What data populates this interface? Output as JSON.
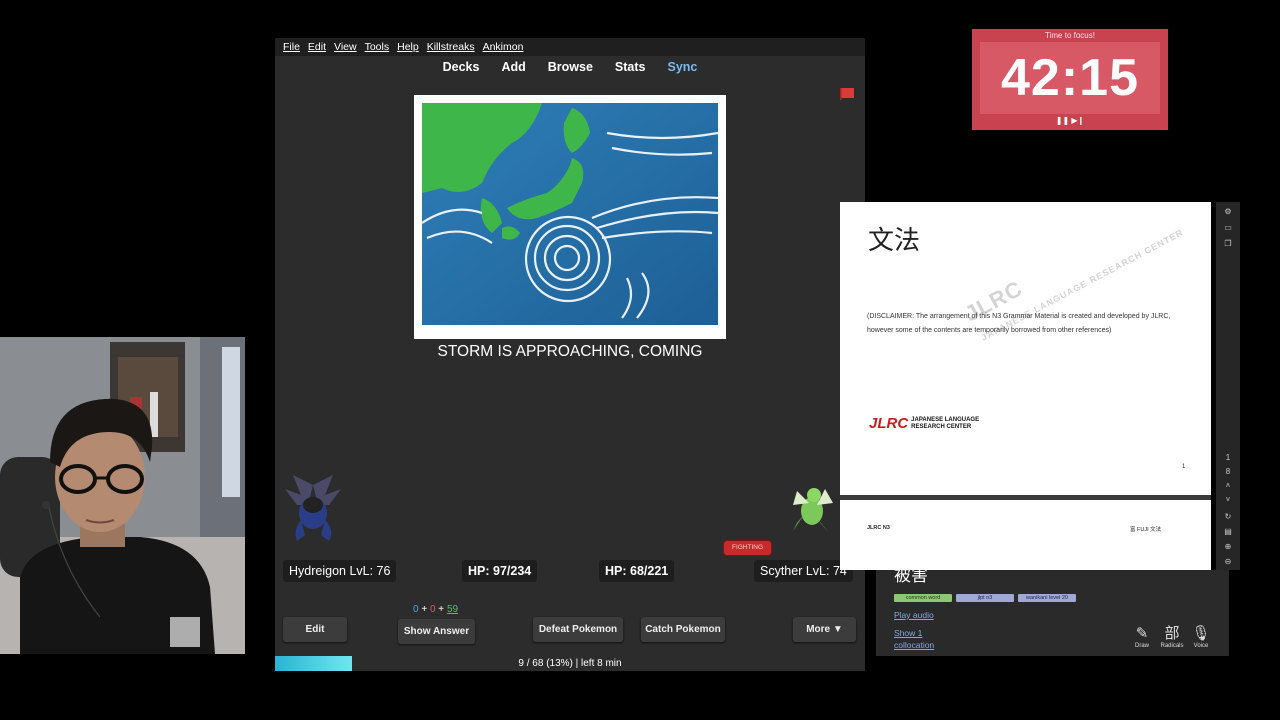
{
  "anki": {
    "menu": [
      "File",
      "Edit",
      "View",
      "Tools",
      "Help",
      "Killstreaks",
      "Ankimon"
    ],
    "toolbar": {
      "decks": "Decks",
      "add": "Add",
      "browse": "Browse",
      "stats": "Stats",
      "sync": "Sync"
    },
    "card_text": "STORM IS APPROACHING, COMING",
    "battle": {
      "player_name": "Hydreigon LvL: 76",
      "player_hp": "HP: 97/234",
      "enemy_hp": "HP: 68/221",
      "enemy_name": "Scyther LvL: 74",
      "enemy_type": "FIGHTING"
    },
    "counts": {
      "new": "0",
      "sep1": " + ",
      "learn": "0",
      "sep2": " + ",
      "review": "59"
    },
    "buttons": {
      "edit": "Edit",
      "show_answer": "Show Answer",
      "defeat": "Defeat Pokemon",
      "catch": "Catch Pokemon",
      "more": "More ▼"
    },
    "progress": {
      "fraction": 0.13,
      "text": "9 / 68 (13%) | left 8 min"
    }
  },
  "timer": {
    "label": "Time to focus!",
    "value": "42:15",
    "controls": "❚❚ ▶❙"
  },
  "pdf": {
    "title": "文法",
    "watermark_big": "JLRC",
    "watermark_small": "JAPANESE LANGUAGE RESEARCH CENTER",
    "disclaimer": "(DISCLAIMER: The arrangement of this N3 Grammar Material is created and developed by JLRC, however some of the contents are temporarily borrowed from other references)",
    "logo_big": "JLRC",
    "logo_small_1": "JAPANESE LANGUAGE",
    "logo_small_2": "RESEARCH CENTER",
    "page_number": "1",
    "page2_left": "JLRC N3",
    "page2_right": "富 FUJI 文法",
    "side_icons": [
      "settings-icon",
      "bookmark-icon",
      "copy-icon",
      "page-icon",
      "chevron-down-icon",
      "refresh-icon",
      "document-icon",
      "zoom-in-icon",
      "zoom-out-icon"
    ],
    "side_page": "1",
    "side_page_total": "8"
  },
  "dictionary": {
    "word": "被害",
    "tags": [
      "common word",
      "jlpt n3",
      "wanikani level 20"
    ],
    "play_audio": "Play audio",
    "show": "Show 1",
    "collocation": "collocation",
    "tools": {
      "draw": "Draw",
      "radicals": "Radicals",
      "voice": "Voice"
    },
    "radicals_glyph": "部"
  },
  "colors": {
    "anki_bg": "#2c2c2c",
    "sync": "#7db8f0",
    "timer_bg": "#c8434f",
    "fighting": "#c62a2a",
    "progress": "#2ab3d4",
    "tag_common": "#8cc870",
    "tag_jlpt": "#a0a8d8"
  }
}
